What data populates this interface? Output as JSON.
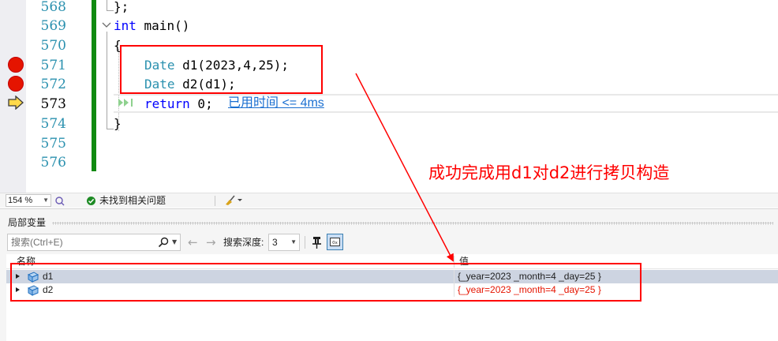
{
  "editor": {
    "line_numbers": [
      "568",
      "569",
      "570",
      "571",
      "572",
      "573",
      "574",
      "575",
      "576"
    ],
    "current_line": "573",
    "breakpoint_lines": [
      "571",
      "572"
    ],
    "code": {
      "line_568": "};",
      "line_569_kw": "int",
      "line_569_fn": " main()",
      "line_570": "{",
      "line_571_type": "Date",
      "line_571_rest": " d1(2023,4,25);",
      "line_572_type": "Date",
      "line_572_rest": " d2(d1);",
      "line_573_kw": "return",
      "line_573_rest": " 0;",
      "line_574": "}"
    },
    "perf_tip": "已用时间 <= 4ms"
  },
  "annotation": {
    "text": "成功完成用d1对d2进行拷贝构造",
    "color": "#ff0000"
  },
  "statusbar": {
    "zoom": "154 %",
    "issues_text": "未找到相关问题"
  },
  "locals_panel": {
    "title": "局部变量",
    "search_placeholder": "搜索(Ctrl+E)",
    "depth_label": "搜索深度:",
    "depth_value": "3",
    "columns": {
      "name": "名称",
      "value": "值"
    },
    "rows": [
      {
        "name": "d1",
        "value": "{_year=2023 _month=4 _day=25 }",
        "changed": false,
        "selected": true
      },
      {
        "name": "d2",
        "value": "{_year=2023 _month=4 _day=25 }",
        "changed": true,
        "selected": false
      }
    ]
  },
  "icons": {
    "breakpoint": "breakpoint-icon",
    "current_statement": "current-statement-arrow-icon",
    "run_to_click": "run-to-click-icon",
    "no_issues": "check-circle-icon",
    "search": "search-icon",
    "back": "back-arrow-icon",
    "forward": "forward-arrow-icon",
    "pin": "pin-icon",
    "hex": "hex-display-icon",
    "object": "object-class-icon"
  },
  "colors": {
    "breakpoint": "#e51400",
    "changed_value": "#e51400",
    "keyword": "#0000ff",
    "type": "#2b91af",
    "accent_link": "#1a6fd1",
    "edit_bar": "#108a10"
  }
}
